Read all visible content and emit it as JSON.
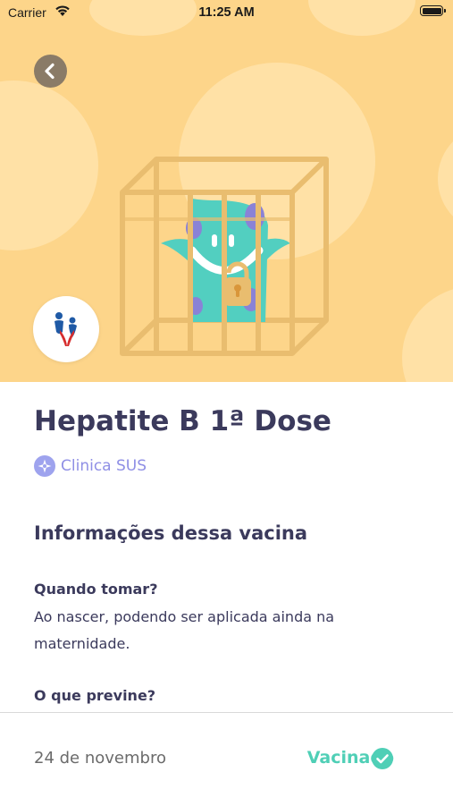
{
  "status_bar": {
    "carrier": "Carrier",
    "time": "11:25 AM"
  },
  "hero": {
    "background_color": "#FDD58A",
    "illustration": "caged-monster-illustration",
    "back_icon": "chevron-left-icon",
    "logo": "sus-clinic-logo"
  },
  "vaccine": {
    "title": "Hepatite B 1ª Dose",
    "clinic": "Clinica SUS"
  },
  "info": {
    "section_title": "Informações dessa vacina",
    "when_label": "Quando tomar?",
    "when_text": "Ao nascer, podendo ser aplicada ainda na maternidade.",
    "prevents_label": "O que previne?"
  },
  "footer": {
    "date": "24 de novembro",
    "status": "Vacinado",
    "status_color": "#4FCFB6",
    "status_icon": "check-circle-icon"
  }
}
